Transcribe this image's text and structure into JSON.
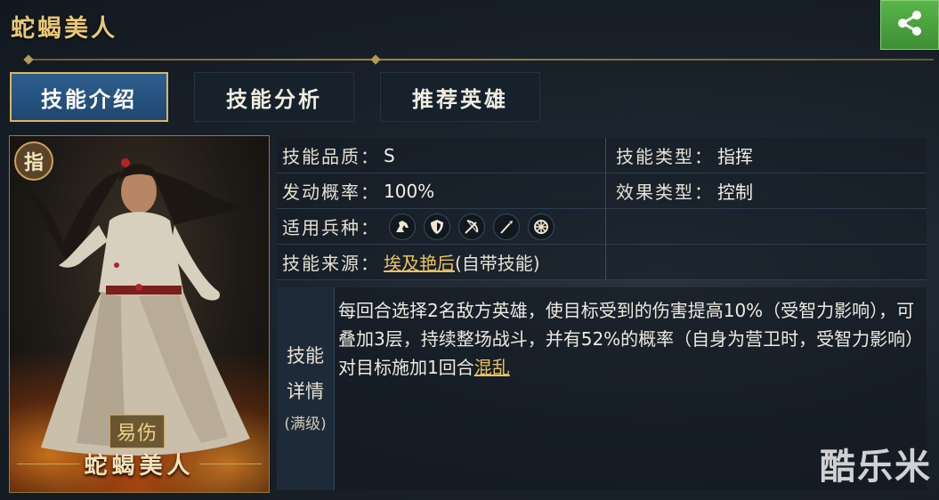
{
  "header": {
    "title": "蛇蝎美人"
  },
  "tabs": [
    {
      "label": "技能介绍",
      "active": true
    },
    {
      "label": "技能分析",
      "active": false
    },
    {
      "label": "推荐英雄",
      "active": false
    }
  ],
  "hero_card": {
    "type_badge": "指",
    "tag": "易伤",
    "name": "蛇蝎美人"
  },
  "info": {
    "quality_label": "技能品质：",
    "quality_value": "S",
    "skill_type_label": "技能类型：",
    "skill_type_value": "指挥",
    "rate_label": "发动概率：",
    "rate_value": "100%",
    "effect_type_label": "效果类型：",
    "effect_type_value": "控制",
    "troops_label": "适用兵种：",
    "troops": [
      "cavalry-icon",
      "shield-icon",
      "archer-icon",
      "spear-icon",
      "siege-icon"
    ],
    "source_label": "技能来源：",
    "source_link": "埃及艳后",
    "source_suffix": "(自带技能)"
  },
  "detail": {
    "label_line1": "技能",
    "label_line2": "详情",
    "label_line3": "(满级)",
    "text_before": "每回合选择2名敌方英雄，使目标受到的伤害提高10%（受智力影响），可叠加3层，持续整场战斗，并有52%的概率（自身为营卫时，受智力影响）对目标施加1回合",
    "text_link": "混乱"
  },
  "watermark": "酷乐米",
  "colors": {
    "accent_gold": "#e8c877",
    "tab_active": "#2e5e8e",
    "share_green": "#4aa53c",
    "link": "#eac35f"
  }
}
